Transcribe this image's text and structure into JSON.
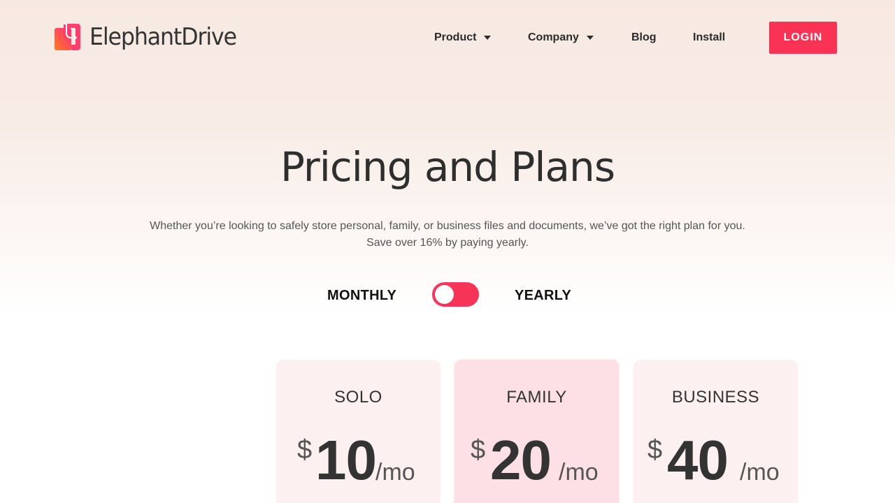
{
  "brand": {
    "name": "ElephantDrive",
    "logo_colors": [
      "#ff6a2c",
      "#ff2d7a"
    ]
  },
  "nav": {
    "items": [
      {
        "label": "Product",
        "has_dropdown": true,
        "icon": "chevron-down-icon"
      },
      {
        "label": "Company",
        "has_dropdown": true,
        "icon": "chevron-down-icon"
      },
      {
        "label": "Blog",
        "has_dropdown": false
      },
      {
        "label": "Install",
        "has_dropdown": false
      }
    ],
    "login_label": "LOGIN"
  },
  "hero": {
    "title": "Pricing and Plans",
    "subtitle_line1": "Whether you’re looking to safely store personal, family, or business files and documents, we’ve got the right plan for you.",
    "subtitle_line2": "Save over 16% by paying yearly."
  },
  "billing_toggle": {
    "left_label": "MONTHLY",
    "right_label": "YEARLY",
    "selected": "MONTHLY"
  },
  "plans": [
    {
      "name": "SOLO",
      "currency": "$",
      "amount": "10",
      "period": "/mo",
      "featured": false
    },
    {
      "name": "FAMILY",
      "currency": "$",
      "amount": "20",
      "period": "/mo",
      "featured": true
    },
    {
      "name": "BUSINESS",
      "currency": "$",
      "amount": "40",
      "period": "/mo",
      "featured": false
    }
  ],
  "colors": {
    "accent": "#fa3355",
    "text_dark": "#333333",
    "card_bg": "#fdf0f1",
    "card_featured_bg": "#fde0e5"
  }
}
